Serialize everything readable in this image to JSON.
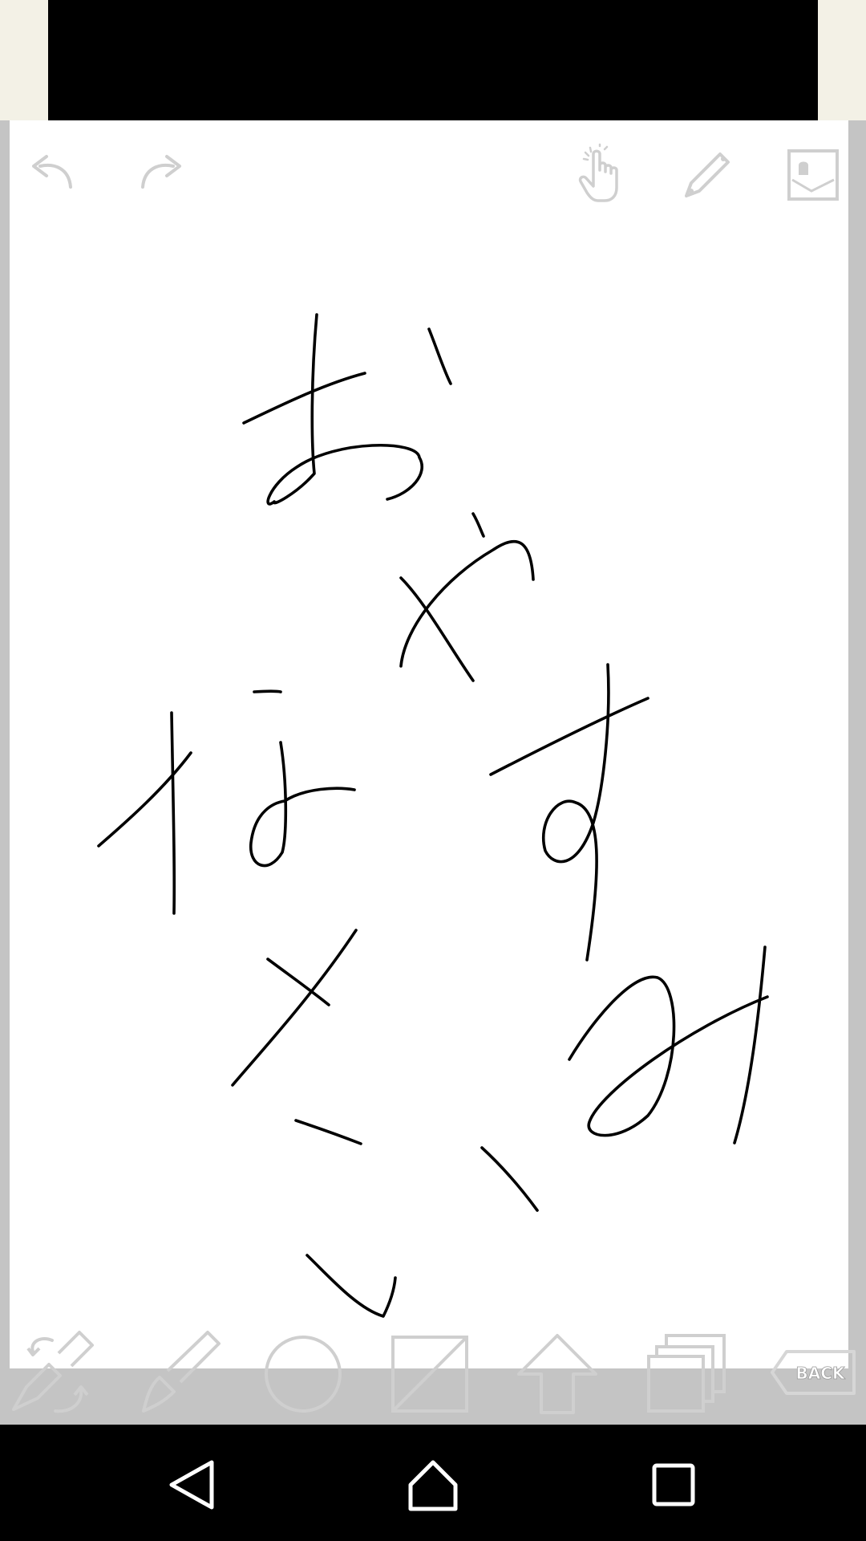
{
  "toolbar_top": {
    "undo_icon": "undo-arrow-icon",
    "redo_icon": "redo-arrow-icon",
    "hand_icon": "hand-pointer-icon",
    "pencil_icon": "pencil-icon",
    "image_icon": "image-icon"
  },
  "toolbar_bottom": {
    "brush_swap_icon": "brush-swap-icon",
    "brush_icon": "brush-icon",
    "circle_icon": "circle-shape-icon",
    "square_icon": "square-shape-icon",
    "upload_icon": "upload-arrow-icon",
    "layers_icon": "layers-icon",
    "back_label": "BACK"
  },
  "canvas": {
    "handwriting": "おやすみなさい"
  },
  "nav": {
    "back_icon": "triangle-back-icon",
    "home_icon": "home-icon",
    "recent_icon": "square-recent-icon"
  },
  "colors": {
    "icon_gray": "#cfcfcf",
    "stroke": "#000000",
    "frame_gray": "#c4c4c4"
  }
}
